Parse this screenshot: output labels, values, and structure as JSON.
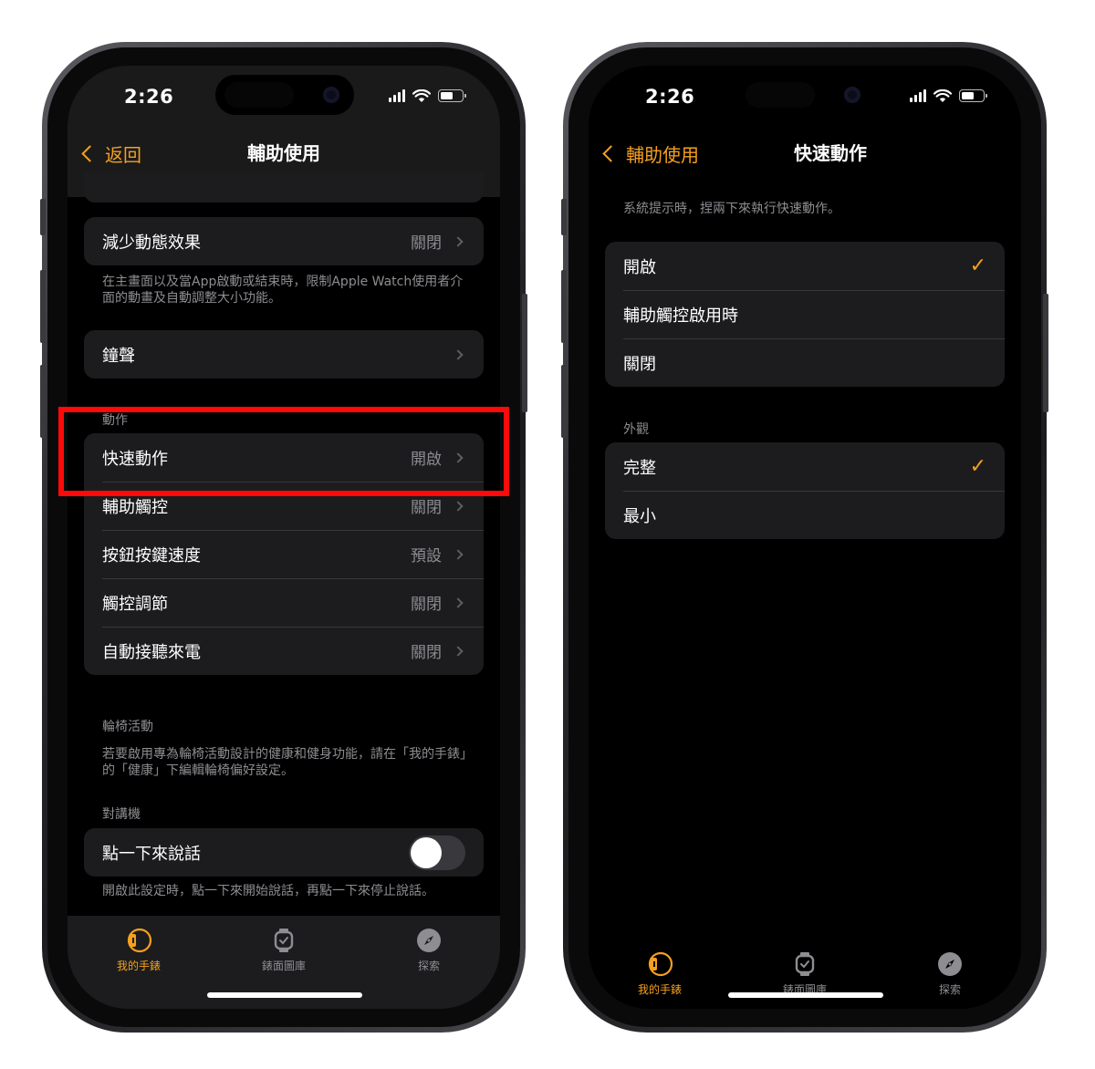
{
  "left_phone": {
    "status_time": "2:26",
    "nav": {
      "back_label": "返回",
      "title": "輔助使用"
    },
    "reduce_motion": {
      "label": "減少動態效果",
      "value": "關閉",
      "footer": "在主畫面以及當App啟動或結束時，限制Apple Watch使用者介面的動畫及自動調整大小功能。"
    },
    "chimes": {
      "label": "鐘聲"
    },
    "actions_section": {
      "header": "動作",
      "rows": [
        {
          "label": "快速動作",
          "value": "開啟"
        },
        {
          "label": "輔助觸控",
          "value": "關閉"
        },
        {
          "label": "按鈕按鍵速度",
          "value": "預設"
        },
        {
          "label": "觸控調節",
          "value": "關閉"
        },
        {
          "label": "自動接聽來電",
          "value": "關閉"
        }
      ]
    },
    "wheelchair": {
      "header": "輪椅活動",
      "footer": "若要啟用專為輪椅活動設計的健康和健身功能，請在「我的手錶」的「健康」下編輯輪椅偏好設定。"
    },
    "walkie_talkie": {
      "header": "對講機",
      "label": "點一下來說話",
      "toggle_on": false,
      "footer": "開啟此設定時，點一下來開始說話，再點一下來停止說話。"
    }
  },
  "right_phone": {
    "status_time": "2:26",
    "nav": {
      "back_label": "輔助使用",
      "title": "快速動作"
    },
    "description": "系統提示時，捏兩下來執行快速動作。",
    "mode_options": [
      {
        "label": "開啟",
        "checked": true
      },
      {
        "label": "輔助觸控啟用時",
        "checked": false
      },
      {
        "label": "關閉",
        "checked": false
      }
    ],
    "appearance": {
      "header": "外觀",
      "options": [
        {
          "label": "完整",
          "checked": true
        },
        {
          "label": "最小",
          "checked": false
        }
      ]
    }
  },
  "tabbar": {
    "tabs": [
      {
        "label": "我的手錶",
        "icon": "watch-side-icon",
        "active": true
      },
      {
        "label": "錶面圖庫",
        "icon": "watch-face-icon",
        "active": false
      },
      {
        "label": "探索",
        "icon": "compass-icon",
        "active": false
      }
    ]
  },
  "colors": {
    "accent": "#f5a01f",
    "highlight": "#ff0a0a",
    "cell_bg": "#1c1c1e"
  }
}
